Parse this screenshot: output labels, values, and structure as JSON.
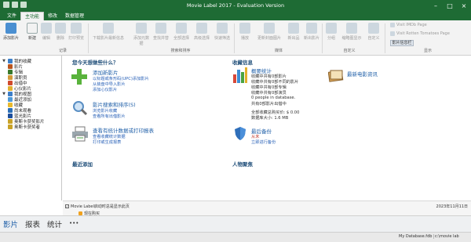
{
  "window": {
    "title": "Movie Label 2017 - Evaluation Version"
  },
  "tabs": [
    "文件",
    "主功能",
    "修改",
    "数据管理"
  ],
  "ribbon": {
    "buttons": [
      "添加影片",
      "新建",
      "编辑",
      "删除",
      "打印预览",
      "下载影片最新信息",
      "添加元数据",
      "查找并替",
      "全部选择",
      "高级选择",
      "快速筛选",
      "播放",
      "更新封面图片",
      "新出品",
      "新出影片",
      "分组",
      "缩略图显示",
      "自定义"
    ],
    "small_buttons": [
      "Visit IMDb Page",
      "Visit Rotten Tomatoes Page"
    ],
    "selected_tag": "影片信息栏",
    "groups": [
      "记录",
      "搜索和排序",
      "媒体",
      "自定义",
      "显示"
    ]
  },
  "sidebar": {
    "items": [
      {
        "label": "我的收藏",
        "toggle": "▼"
      },
      {
        "label": "影片"
      },
      {
        "label": "专辑"
      },
      {
        "label": "演职员"
      },
      {
        "label": "出借中"
      },
      {
        "label": "心仪影片"
      },
      {
        "label": "我的视图",
        "toggle": "▼"
      },
      {
        "label": "最近添加"
      },
      {
        "label": "收藏"
      },
      {
        "label": "尚未观看"
      },
      {
        "label": "蓝光影片"
      },
      {
        "label": "奥斯卡获奖影片"
      },
      {
        "label": "奥斯卡获奖者"
      }
    ]
  },
  "main": {
    "what_to_do": "您今天想做些什么？",
    "collection_info": "收藏信息",
    "add_movie": {
      "title": "添加新影片",
      "links": [
        "以标题或条形码(UPC)添加影片",
        "从装盘中导入影片",
        "添加心仪影片"
      ]
    },
    "search": {
      "title": "影片搜索和排序(S)",
      "links": [
        "浏览影片收藏",
        "查看所有出借影片"
      ]
    },
    "reports": {
      "title": "查看有统计数据或打印报表",
      "links": [
        "查看收藏统计数据",
        "打印或生成报表"
      ]
    },
    "recent_added": "最近添加",
    "overview": {
      "title": "概要统计",
      "lines": [
        "收藏中共有0部影片",
        "收藏中共有0部不同的影片",
        "收藏中共有0部专辑",
        "收藏中共有0部演员",
        "0 people in database.",
        "共有0部影片出借中",
        "全部收藏总购买价: $ 0.00",
        "数据库大小: 1.6 MB"
      ]
    },
    "news": {
      "title": "最新电影资讯"
    },
    "backup": {
      "title": "最后备份",
      "status": "从未",
      "action": "立即进行备份"
    },
    "people_focus": "人物聚焦",
    "date": "2023年11月11日"
  },
  "statusline": {
    "checkbox_label": "Movie Label启动时总是显示此页",
    "buy": "现在购买"
  },
  "bottom_tabs": [
    "影片",
    "报表",
    "统计"
  ],
  "more": "•••",
  "statusbar": {
    "db": "My Database.fdb",
    "path": "c:\\movie lab"
  }
}
